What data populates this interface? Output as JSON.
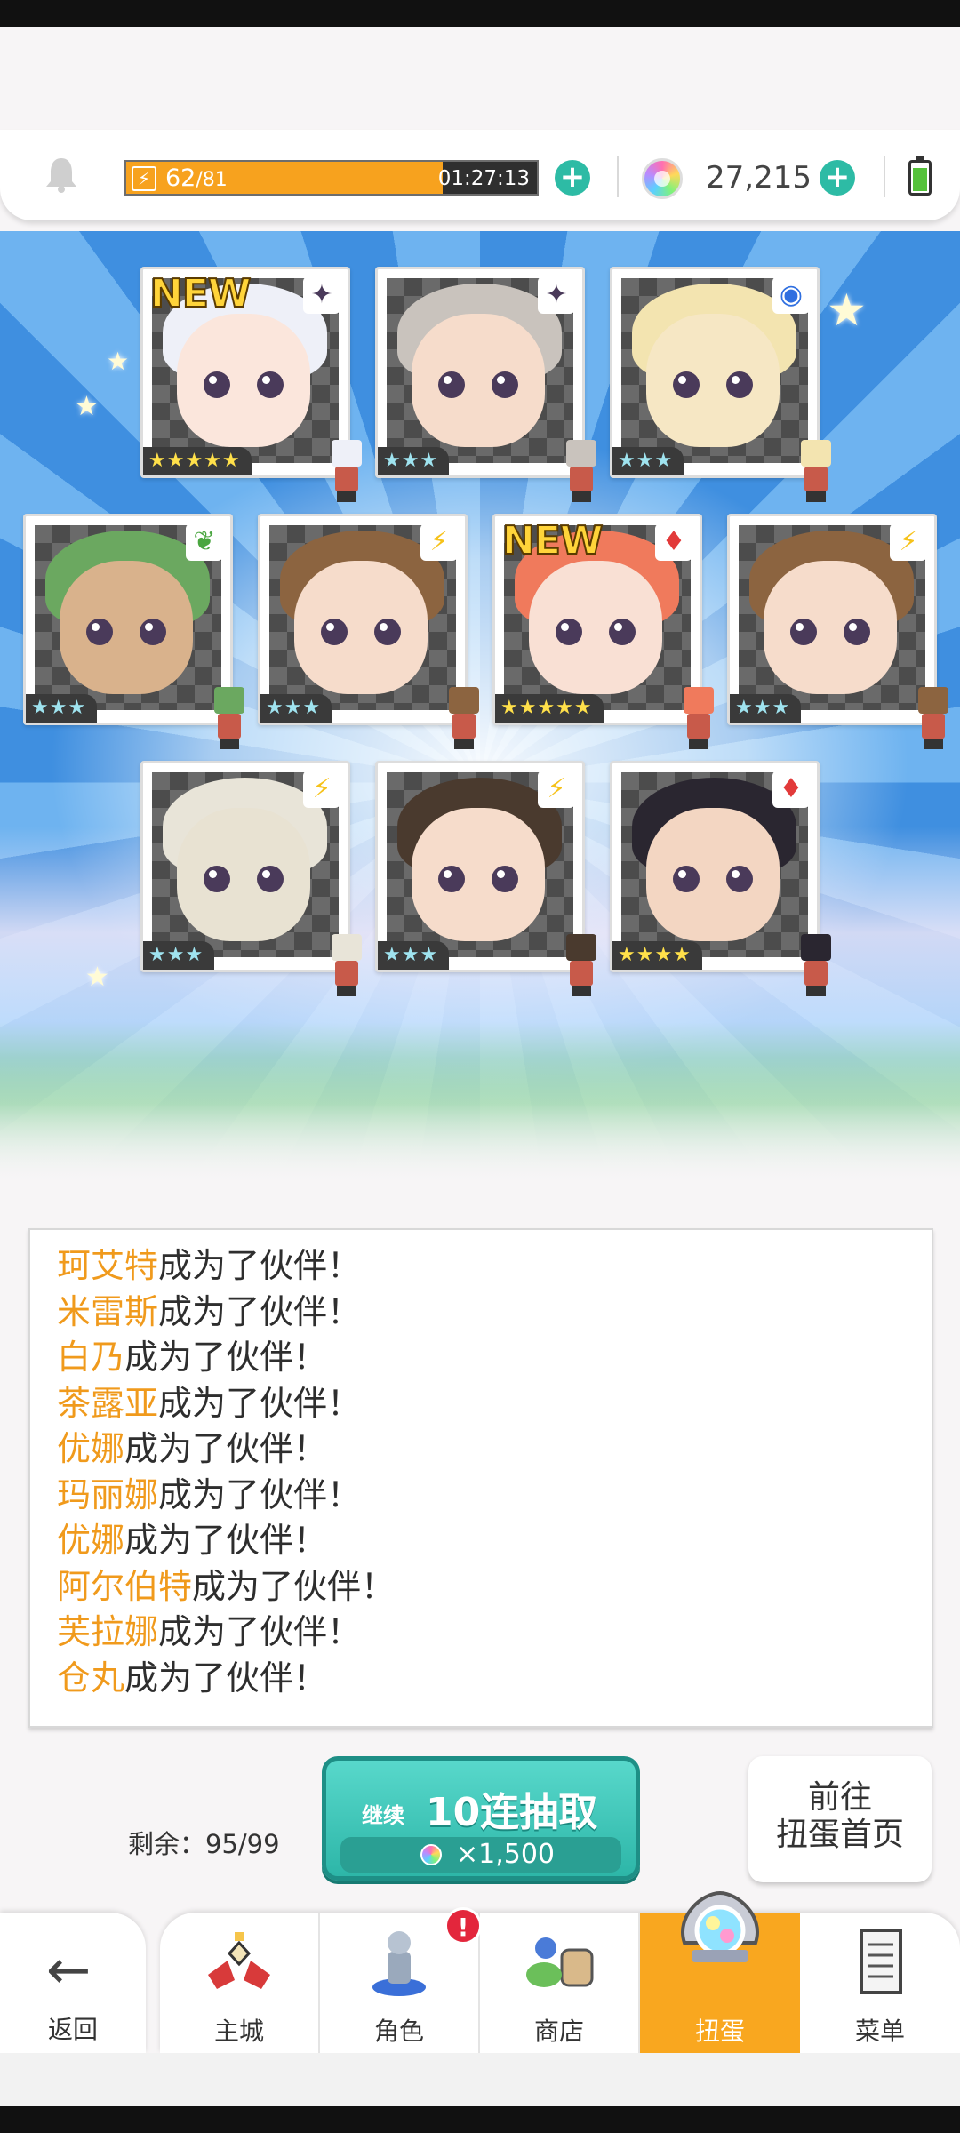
{
  "stamina": {
    "current": "62",
    "max": "/81",
    "timer": "01:27:13",
    "fill_fraction": 0.77
  },
  "gems": {
    "value": "27,215"
  },
  "colors": {
    "accent_orange": "#f9a71f",
    "teal": "#2dbba5",
    "name_color": "#f09a1c"
  },
  "cards_row1": [
    {
      "new": "NEW",
      "stars": "★★★★★",
      "gold": true,
      "attr_icon": "dark-star-icon",
      "attr": "✦",
      "hair": "#eef0f8",
      "skin": "#fbe6dc"
    },
    {
      "new": "",
      "stars": "★★★",
      "gold": false,
      "attr_icon": "light-sparkle-icon",
      "attr": "✦",
      "hair": "#c9c3bd",
      "skin": "#f6dccb"
    },
    {
      "new": "",
      "stars": "★★★",
      "gold": false,
      "attr_icon": "blue-circle-icon",
      "attr": "◉",
      "hair": "#f3e4b0",
      "skin": "#f6e7c4"
    }
  ],
  "cards_row2": [
    {
      "new": "",
      "stars": "★★★",
      "gold": false,
      "attr_icon": "leaf-icon",
      "attr": "❦",
      "hair": "#6ba860",
      "skin": "#d9b28c"
    },
    {
      "new": "",
      "stars": "★★★",
      "gold": false,
      "attr_icon": "lightning-icon",
      "attr": "⚡",
      "hair": "#8c6440",
      "skin": "#f6dccb"
    },
    {
      "new": "NEW",
      "stars": "★★★★★",
      "gold": true,
      "attr_icon": "fire-diamonds-icon",
      "attr": "♦",
      "hair": "#f07a5c",
      "skin": "#f9e0d4"
    },
    {
      "new": "",
      "stars": "★★★",
      "gold": false,
      "attr_icon": "lightning-icon",
      "attr": "⚡",
      "hair": "#8c6440",
      "skin": "#f6dccb"
    }
  ],
  "cards_row3": [
    {
      "new": "",
      "stars": "★★★",
      "gold": false,
      "attr_icon": "lightning-icon",
      "attr": "⚡",
      "hair": "#e8e4d8",
      "skin": "#e8e2d2"
    },
    {
      "new": "",
      "stars": "★★★",
      "gold": false,
      "attr_icon": "lightning-icon",
      "attr": "⚡",
      "hair": "#4a3a2e",
      "skin": "#f6dccb"
    },
    {
      "new": "",
      "stars": "★★★★",
      "gold": true,
      "attr_icon": "fire-diamonds-icon",
      "attr": "♦",
      "hair": "#2a2630",
      "skin": "#f3d6c2"
    }
  ],
  "messages": [
    {
      "name": "珂艾特",
      "text": "成为了伙伴！"
    },
    {
      "name": "米雷斯",
      "text": "成为了伙伴！"
    },
    {
      "name": "白乃",
      "text": "成为了伙伴！"
    },
    {
      "name": "茶露亚",
      "text": "成为了伙伴！"
    },
    {
      "name": "优娜",
      "text": "成为了伙伴！"
    },
    {
      "name": "玛丽娜",
      "text": "成为了伙伴！"
    },
    {
      "name": "优娜",
      "text": "成为了伙伴！"
    },
    {
      "name": "阿尔伯特",
      "text": "成为了伙伴！"
    },
    {
      "name": "芙拉娜",
      "text": "成为了伙伴！"
    },
    {
      "name": "仓丸",
      "text": "成为了伙伴！"
    }
  ],
  "remaining": "剩余：95/99",
  "pull_button": {
    "prefix": "继续",
    "label": "10连抽取",
    "cost": "×1,500"
  },
  "goto_button": {
    "line1": "前往",
    "line2": "扭蛋首页"
  },
  "nav": {
    "back": "返回",
    "tabs": [
      {
        "label": "主城",
        "icon": "castle-icon",
        "active": false
      },
      {
        "label": "角色",
        "icon": "character-icon",
        "active": false,
        "badge": "!"
      },
      {
        "label": "商店",
        "icon": "shop-icon",
        "active": false
      },
      {
        "label": "扭蛋",
        "icon": "gacha-icon",
        "active": true
      },
      {
        "label": "菜单",
        "icon": "menu-list-icon",
        "active": false
      }
    ]
  }
}
